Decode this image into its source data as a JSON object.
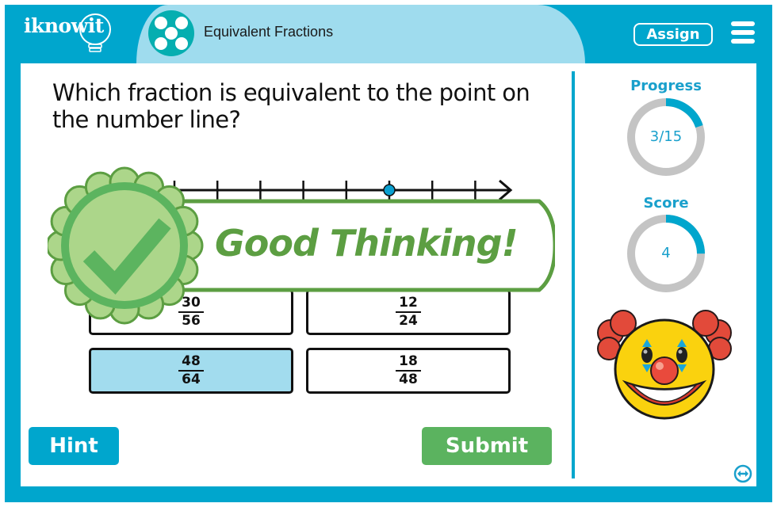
{
  "header": {
    "logo_text": "iknowit",
    "topic_title": "Equivalent Fractions",
    "assign_label": "Assign",
    "menu_icon": "hamburger-menu-icon"
  },
  "question": {
    "text": "Which fraction is equivalent to the point on the number line?"
  },
  "number_line": {
    "tick_count": 8,
    "point_tick_index": 5,
    "point_color": "#0aa0d0"
  },
  "answers": [
    {
      "numerator": "30",
      "denominator": "56",
      "selected": false
    },
    {
      "numerator": "12",
      "denominator": "24",
      "selected": false
    },
    {
      "numerator": "48",
      "denominator": "64",
      "selected": true
    },
    {
      "numerator": "18",
      "denominator": "48",
      "selected": false
    }
  ],
  "buttons": {
    "hint_label": "Hint",
    "submit_label": "Submit"
  },
  "feedback": {
    "text": "Good Thinking!",
    "icon": "checkmark-badge-icon"
  },
  "sidebar": {
    "progress": {
      "label": "Progress",
      "value_text": "3/15",
      "current": 3,
      "total": 15,
      "fraction": 0.2
    },
    "score": {
      "label": "Score",
      "value_text": "4",
      "fraction": 0.25
    },
    "mascot": "clown-face-icon",
    "resize_icon": "resize-arrows-icon"
  },
  "colors": {
    "frame": "#00a6cd",
    "title_tab": "#9fdcee",
    "topic_icon": "#05aeb0",
    "hint": "#00a6cd",
    "submit": "#5bb35f",
    "selected_answer": "#a2dcee",
    "ring_track": "#c4c4c4",
    "ring_fill": "#00a6cd",
    "feedback_green": "#5c9e42"
  }
}
